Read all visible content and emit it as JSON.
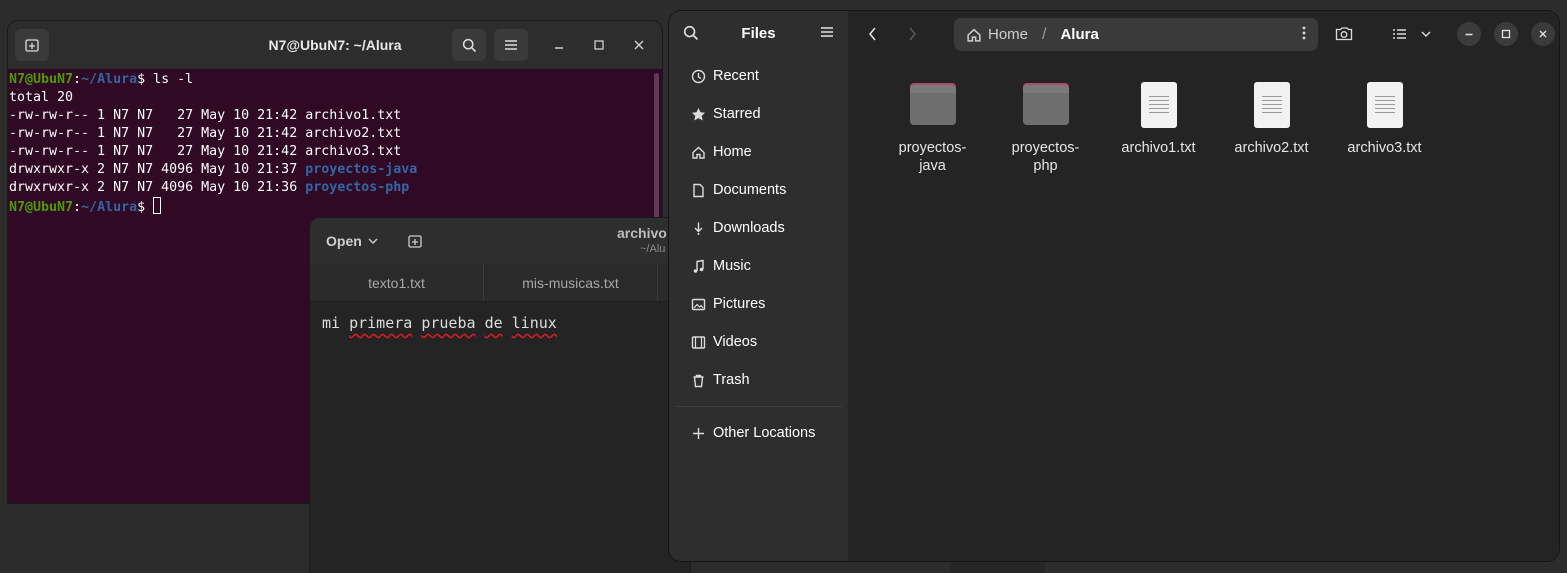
{
  "terminal": {
    "title": "N7@UbuN7: ~/Alura",
    "prompt_user": "N7@UbuN7",
    "prompt_path": "~/Alura",
    "command": "ls -l",
    "lines": [
      "total 20",
      "-rw-rw-r-- 1 N7 N7   27 May 10 21:42 archivo1.txt",
      "-rw-rw-r-- 1 N7 N7   27 May 10 21:42 archivo2.txt",
      "-rw-rw-r-- 1 N7 N7   27 May 10 21:42 archivo3.txt"
    ],
    "dir_lines": [
      {
        "prefix": "drwxrwxr-x 2 N7 N7 4096 May 10 21:37 ",
        "name": "proyectos-java"
      },
      {
        "prefix": "drwxrwxr-x 2 N7 N7 4096 May 10 21:36 ",
        "name": "proyectos-php"
      }
    ]
  },
  "editor": {
    "open_label": "Open",
    "title": "archivo",
    "subtitle": "~/Alu",
    "tabs": [
      "texto1.txt",
      "mis-musicas.txt"
    ],
    "content_words": [
      "mi",
      "primera",
      "prueba",
      "de",
      "linux"
    ]
  },
  "files": {
    "app_title": "Files",
    "sidebar": {
      "items": [
        "Recent",
        "Starred",
        "Home",
        "Documents",
        "Downloads",
        "Music",
        "Pictures",
        "Videos",
        "Trash"
      ],
      "other": "Other Locations"
    },
    "path": {
      "home": "Home",
      "current": "Alura"
    },
    "items": [
      {
        "name": "proyectos-\njava",
        "kind": "folder"
      },
      {
        "name": "proyectos-\nphp",
        "kind": "folder"
      },
      {
        "name": "archivo1.txt",
        "kind": "file"
      },
      {
        "name": "archivo2.txt",
        "kind": "file"
      },
      {
        "name": "archivo3.txt",
        "kind": "file"
      }
    ]
  },
  "colors": {
    "terminal_bg": "#300a24",
    "prompt_user": "#4e9a06",
    "prompt_path": "#3465a4",
    "folder_accent": "#b04a6a",
    "spell_error": "#e01b24"
  }
}
